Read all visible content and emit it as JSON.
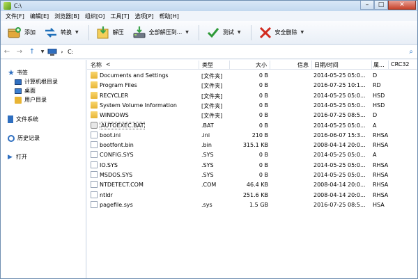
{
  "window": {
    "title": "C:\\"
  },
  "menu": [
    "文件[F]",
    "编辑[E]",
    "浏览器[B]",
    "组织[O]",
    "工具[T]",
    "选项[P]",
    "帮助[H]"
  ],
  "toolbar": {
    "add": "添加",
    "convert": "转换",
    "extract": "解压",
    "extract_all": "全部解压到...",
    "test": "测试",
    "secure_delete": "安全删除"
  },
  "address": {
    "path": "C:"
  },
  "sidebar": {
    "bookmarks": "书签",
    "computer_root": "计算机根目录",
    "desktop": "桌面",
    "user_dir": "用户目录",
    "filesystem": "文件系统",
    "history": "历史记录",
    "open": "打开"
  },
  "columns": {
    "name": "名称",
    "sort": "<",
    "type": "类型",
    "size": "大小",
    "info": "信息",
    "date": "日期/时间",
    "attr": "属...",
    "crc": "CRC32"
  },
  "files": [
    {
      "name": "Documents and Settings",
      "type": "[文件夹]",
      "size": "0 B",
      "date": "2014-05-25 05:0...",
      "attr": "D",
      "icon": "folder"
    },
    {
      "name": "Program Files",
      "type": "[文件夹]",
      "size": "0 B",
      "date": "2016-07-25 10:1...",
      "attr": "RD",
      "icon": "folder"
    },
    {
      "name": "RECYCLER",
      "type": "[文件夹]",
      "size": "0 B",
      "date": "2014-05-25 05:0...",
      "attr": "HSD",
      "icon": "folder"
    },
    {
      "name": "System Volume Information",
      "type": "[文件夹]",
      "size": "0 B",
      "date": "2014-05-25 05:0...",
      "attr": "HSD",
      "icon": "folder"
    },
    {
      "name": "WINDOWS",
      "type": "[文件夹]",
      "size": "0 B",
      "date": "2016-07-25 08:5...",
      "attr": "D",
      "icon": "folder"
    },
    {
      "name": "AUTOEXEC.BAT",
      "type": ".BAT",
      "size": "0 B",
      "date": "2014-05-25 05:0...",
      "attr": "A",
      "icon": "bat"
    },
    {
      "name": "boot.ini",
      "type": ".ini",
      "size": "210 B",
      "date": "2016-06-07 15:3...",
      "attr": "RHSA",
      "icon": "doc"
    },
    {
      "name": "bootfont.bin",
      "type": ".bin",
      "size": "315.1 KB",
      "date": "2008-04-14 20:0...",
      "attr": "RHSA",
      "icon": "doc"
    },
    {
      "name": "CONFIG.SYS",
      "type": ".SYS",
      "size": "0 B",
      "date": "2014-05-25 05:0...",
      "attr": "A",
      "icon": "doc"
    },
    {
      "name": "IO.SYS",
      "type": ".SYS",
      "size": "0 B",
      "date": "2014-05-25 05:0...",
      "attr": "RHSA",
      "icon": "doc"
    },
    {
      "name": "MSDOS.SYS",
      "type": ".SYS",
      "size": "0 B",
      "date": "2014-05-25 05:0...",
      "attr": "RHSA",
      "icon": "doc"
    },
    {
      "name": "NTDETECT.COM",
      "type": ".COM",
      "size": "46.4 KB",
      "date": "2008-04-14 20:0...",
      "attr": "RHSA",
      "icon": "doc"
    },
    {
      "name": "ntldr",
      "type": "",
      "size": "251.6 KB",
      "date": "2008-04-14 20:0...",
      "attr": "RHSA",
      "icon": "doc"
    },
    {
      "name": "pagefile.sys",
      "type": ".sys",
      "size": "1.5 GB",
      "date": "2016-07-25 08:5...",
      "attr": "HSA",
      "icon": "doc"
    }
  ]
}
